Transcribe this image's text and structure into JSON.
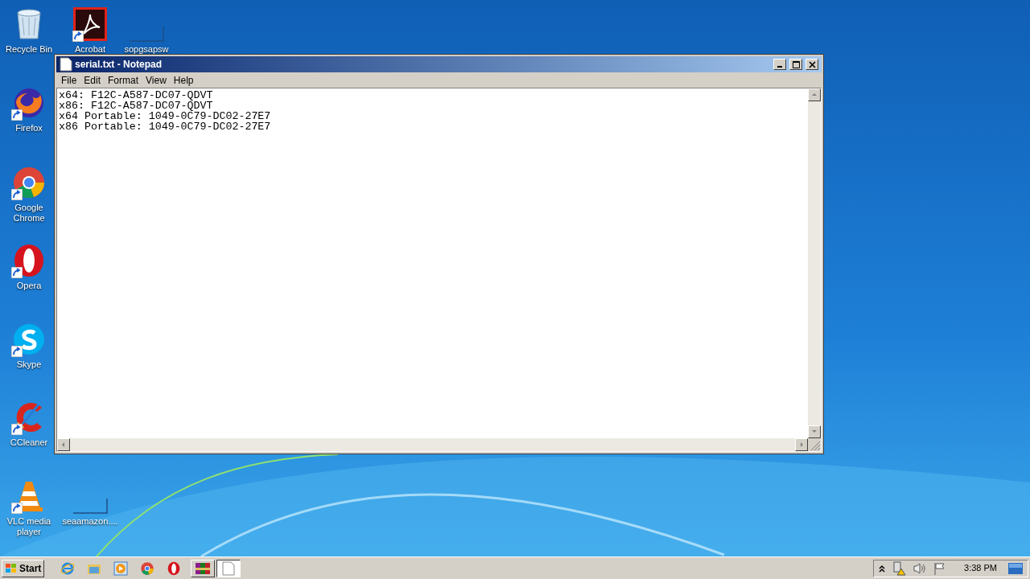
{
  "desktop_icons": [
    {
      "kind": "recycle",
      "label": "Recycle Bin",
      "shortcut": false
    },
    {
      "kind": "firefox",
      "label": "Firefox",
      "shortcut": true
    },
    {
      "kind": "chrome",
      "label": "Google Chrome",
      "shortcut": true
    },
    {
      "kind": "opera",
      "label": "Opera",
      "shortcut": true
    },
    {
      "kind": "skype",
      "label": "Skype",
      "shortcut": true
    },
    {
      "kind": "ccleaner",
      "label": "CCleaner",
      "shortcut": true
    },
    {
      "kind": "vlc",
      "label": "VLC media player",
      "shortcut": true
    }
  ],
  "desktop_icons_col2": [
    {
      "kind": "acrobat",
      "label": "Acrobat",
      "shortcut": true
    },
    {
      "kind": "blank",
      "label": "sopgsapsw",
      "shortcut": false
    }
  ],
  "desktop_icons_bottom": [
    {
      "kind": "blank",
      "label": "seaamazon....",
      "shortcut": false
    }
  ],
  "window": {
    "title": "serial.txt - Notepad",
    "menu": [
      "File",
      "Edit",
      "Format",
      "View",
      "Help"
    ],
    "lines": [
      "x64: F12C-A587-DC07-QDVT",
      "x86: F12C-A587-DC07-QDVT",
      "x64 Portable: 1049-0C79-DC02-27E7",
      "x86 Portable: 1049-0C79-DC02-27E7"
    ]
  },
  "taskbar": {
    "start": "Start",
    "quick_launch": [
      {
        "kind": "ie"
      },
      {
        "kind": "explorer"
      },
      {
        "kind": "media"
      },
      {
        "kind": "chrome"
      },
      {
        "kind": "opera"
      }
    ],
    "tasks": [
      {
        "kind": "winrar",
        "selected": false
      },
      {
        "kind": "notepad",
        "selected": true
      }
    ],
    "tray": [
      {
        "kind": "chevron"
      },
      {
        "kind": "network"
      },
      {
        "kind": "volume"
      },
      {
        "kind": "flag"
      }
    ],
    "clock": "3:38 PM"
  }
}
